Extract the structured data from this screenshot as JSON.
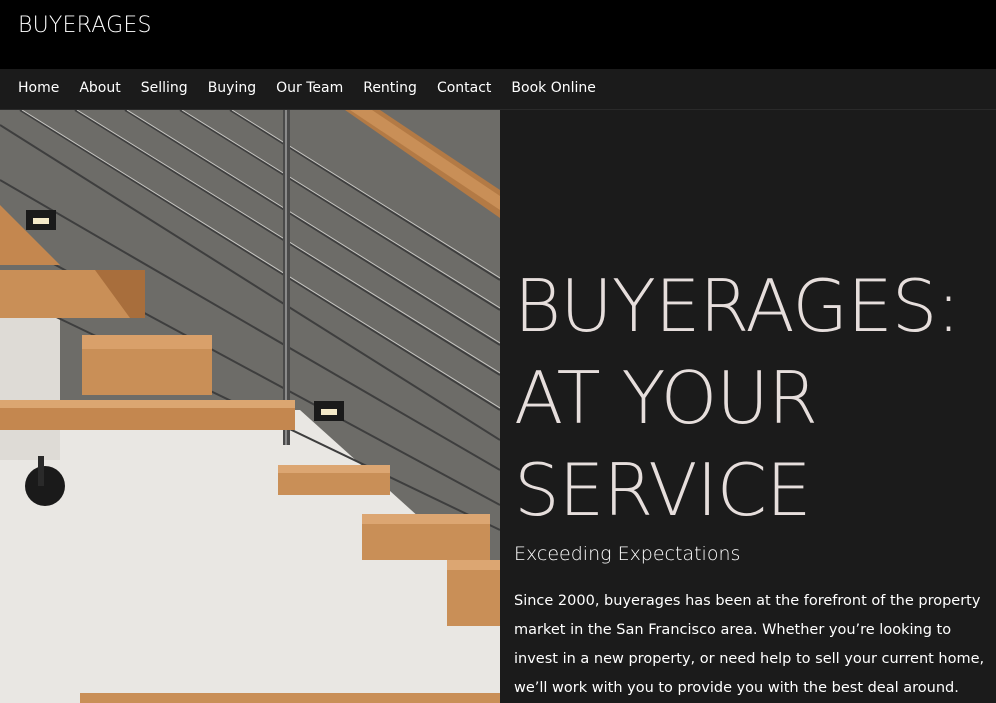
{
  "site": {
    "brand": "BUYERAGES"
  },
  "nav": {
    "items": [
      {
        "label": "Home"
      },
      {
        "label": "About"
      },
      {
        "label": "Selling"
      },
      {
        "label": "Buying"
      },
      {
        "label": "Our Team"
      },
      {
        "label": "Renting"
      },
      {
        "label": "Contact"
      },
      {
        "label": "Book Online"
      }
    ]
  },
  "hero": {
    "headline_lines": [
      "BUYERAGES:",
      "AT YOUR",
      "SERVICE"
    ],
    "subhead": "Exceeding Expectations",
    "description": "Since 2000, buyerages has been at the forefront of the property market in the San Francisco area. Whether you’re looking to invest in a new property, or need help to sell your current home, we’ll work with you to provide you with the best deal around."
  },
  "colors": {
    "header_bg": "#000000",
    "nav_bg": "#1b1b1b",
    "content_bg": "#1b1b1b",
    "headline": "#e6dedc"
  }
}
